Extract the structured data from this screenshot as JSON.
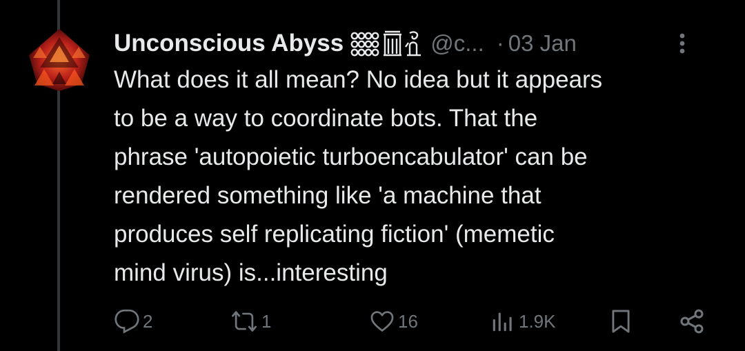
{
  "author": {
    "display_name": "Unconscious Abyss",
    "name_emoji": "𐤀𓁿𓁾",
    "handle": "@c...",
    "date_separator": "·",
    "date": "03 Jan"
  },
  "tweet": {
    "text": "What does it all mean? No idea but it appears\nto be a way to coordinate bots. That the\nphrase 'autopoietic turboencabulator' can be\nrendered something like 'a machine that\nproduces self replicating fiction' (memetic\nmind virus) is...interesting"
  },
  "actions": {
    "replies": "2",
    "reposts": "1",
    "likes": "16",
    "views": "1.9K"
  },
  "icons": {
    "more": "more-vertical-icon",
    "reply": "reply-icon",
    "repost": "repost-icon",
    "like": "heart-icon",
    "views": "views-icon",
    "bookmark": "bookmark-icon",
    "share": "share-icon"
  },
  "colors": {
    "background": "#000000",
    "text": "#e7e9ea",
    "muted": "#71767b",
    "thread_line": "#333639"
  }
}
